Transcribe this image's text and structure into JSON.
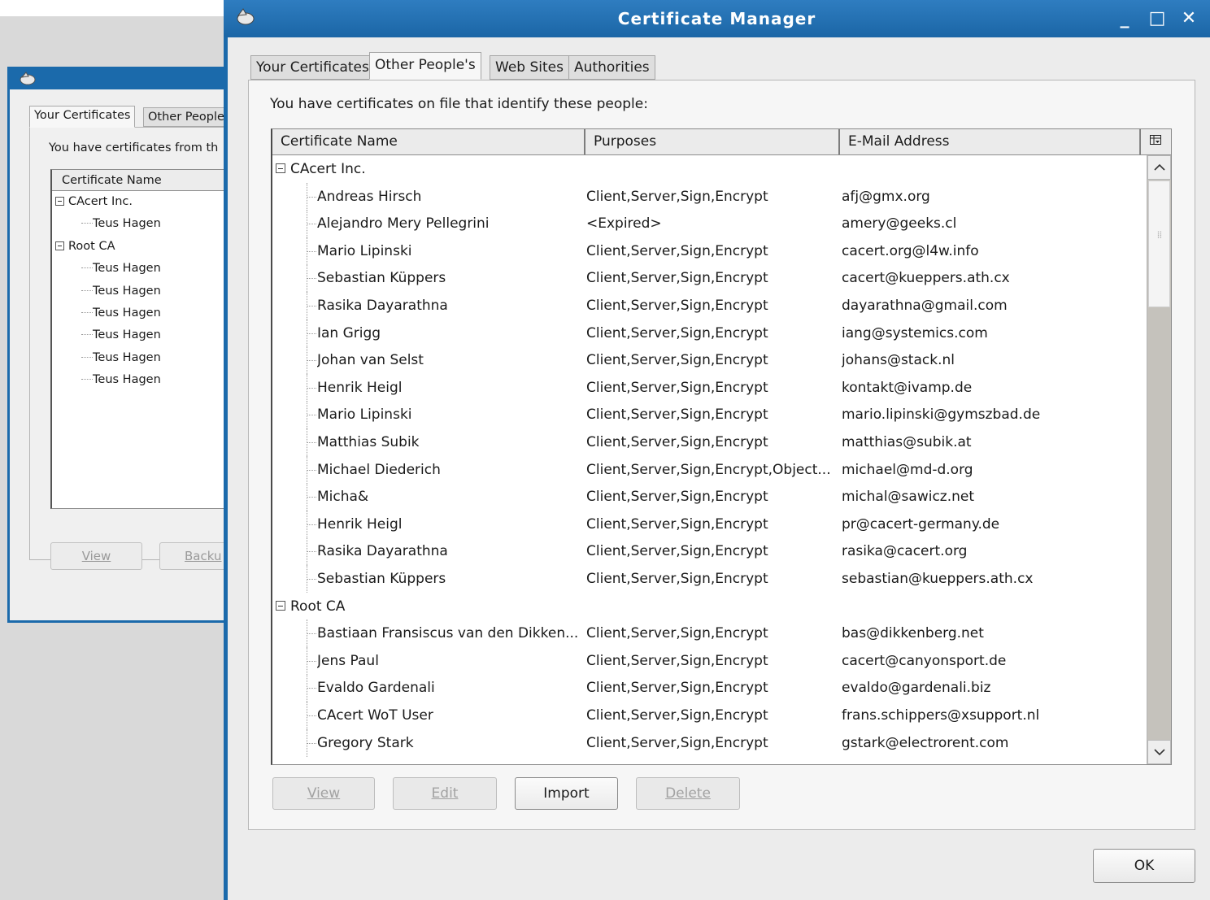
{
  "back_window": {
    "tabs": [
      "Your Certificates",
      "Other People"
    ],
    "description": "You have certificates from th",
    "column_header": "Certificate Name",
    "tree": [
      {
        "label": "CAcert Inc.",
        "type": "group"
      },
      {
        "label": "Teus Hagen",
        "type": "child"
      },
      {
        "label": "Root CA",
        "type": "group"
      },
      {
        "label": "Teus Hagen",
        "type": "child"
      },
      {
        "label": "Teus Hagen",
        "type": "child"
      },
      {
        "label": "Teus Hagen",
        "type": "child"
      },
      {
        "label": "Teus Hagen",
        "type": "child"
      },
      {
        "label": "Teus Hagen",
        "type": "child"
      },
      {
        "label": "Teus Hagen",
        "type": "child"
      }
    ],
    "buttons": {
      "view": "View",
      "backup": "Backu"
    }
  },
  "window": {
    "title": "Certificate Manager",
    "controls": {
      "minimize": "_",
      "maximize": "□",
      "close": "✕"
    }
  },
  "tabs": [
    {
      "label": "Your Certificates",
      "active": false
    },
    {
      "label": "Other People's",
      "active": true
    },
    {
      "label": "Web Sites",
      "active": false
    },
    {
      "label": "Authorities",
      "active": false
    }
  ],
  "description": "You have certificates on file that identify these people:",
  "columns": {
    "name": "Certificate Name",
    "purposes": "Purposes",
    "email": "E-Mail Address"
  },
  "groups": [
    {
      "label": "CAcert Inc.",
      "rows": [
        {
          "name": "Andreas Hirsch",
          "purposes": "Client,Server,Sign,Encrypt",
          "email": "afj@gmx.org"
        },
        {
          "name": "Alejandro Mery Pellegrini",
          "purposes": "<Expired>",
          "email": "amery@geeks.cl"
        },
        {
          "name": "Mario Lipinski",
          "purposes": "Client,Server,Sign,Encrypt",
          "email": "cacert.org@l4w.info"
        },
        {
          "name": "Sebastian Küppers",
          "purposes": "Client,Server,Sign,Encrypt",
          "email": "cacert@kueppers.ath.cx"
        },
        {
          "name": "Rasika Dayarathna",
          "purposes": "Client,Server,Sign,Encrypt",
          "email": "dayarathna@gmail.com"
        },
        {
          "name": "Ian Grigg",
          "purposes": "Client,Server,Sign,Encrypt",
          "email": "iang@systemics.com"
        },
        {
          "name": "Johan van Selst",
          "purposes": "Client,Server,Sign,Encrypt",
          "email": "johans@stack.nl"
        },
        {
          "name": "Henrik Heigl",
          "purposes": "Client,Server,Sign,Encrypt",
          "email": "kontakt@ivamp.de"
        },
        {
          "name": "Mario Lipinski",
          "purposes": "Client,Server,Sign,Encrypt",
          "email": "mario.lipinski@gymszbad.de"
        },
        {
          "name": "Matthias Subik",
          "purposes": "Client,Server,Sign,Encrypt",
          "email": "matthias@subik.at"
        },
        {
          "name": "Michael Diederich",
          "purposes": "Client,Server,Sign,Encrypt,Object...",
          "email": "michael@md-d.org"
        },
        {
          "name": "Micha&",
          "purposes": "Client,Server,Sign,Encrypt",
          "email": "michal@sawicz.net"
        },
        {
          "name": "Henrik Heigl",
          "purposes": "Client,Server,Sign,Encrypt",
          "email": "pr@cacert-germany.de"
        },
        {
          "name": "Rasika Dayarathna",
          "purposes": "Client,Server,Sign,Encrypt",
          "email": "rasika@cacert.org"
        },
        {
          "name": "Sebastian Küppers",
          "purposes": "Client,Server,Sign,Encrypt",
          "email": "sebastian@kueppers.ath.cx"
        }
      ]
    },
    {
      "label": "Root CA",
      "rows": [
        {
          "name": "Bastiaan Fransiscus van den Dikken...",
          "purposes": "Client,Server,Sign,Encrypt",
          "email": "bas@dikkenberg.net"
        },
        {
          "name": "Jens Paul",
          "purposes": "Client,Server,Sign,Encrypt",
          "email": "cacert@canyonsport.de"
        },
        {
          "name": "Evaldo Gardenali",
          "purposes": "Client,Server,Sign,Encrypt",
          "email": "evaldo@gardenali.biz"
        },
        {
          "name": "CAcert WoT User",
          "purposes": "Client,Server,Sign,Encrypt",
          "email": "frans.schippers@xsupport.nl"
        },
        {
          "name": "Gregory Stark",
          "purposes": "Client,Server,Sign,Encrypt",
          "email": "gstark@electrorent.com"
        }
      ]
    }
  ],
  "buttons": {
    "view": "View",
    "edit": "Edit",
    "import": "Import",
    "delete": "Delete",
    "ok": "OK"
  },
  "colors": {
    "titlebar": "#1b6aab",
    "window_bg": "#ececec",
    "disabled_text": "#a2a2a2"
  }
}
